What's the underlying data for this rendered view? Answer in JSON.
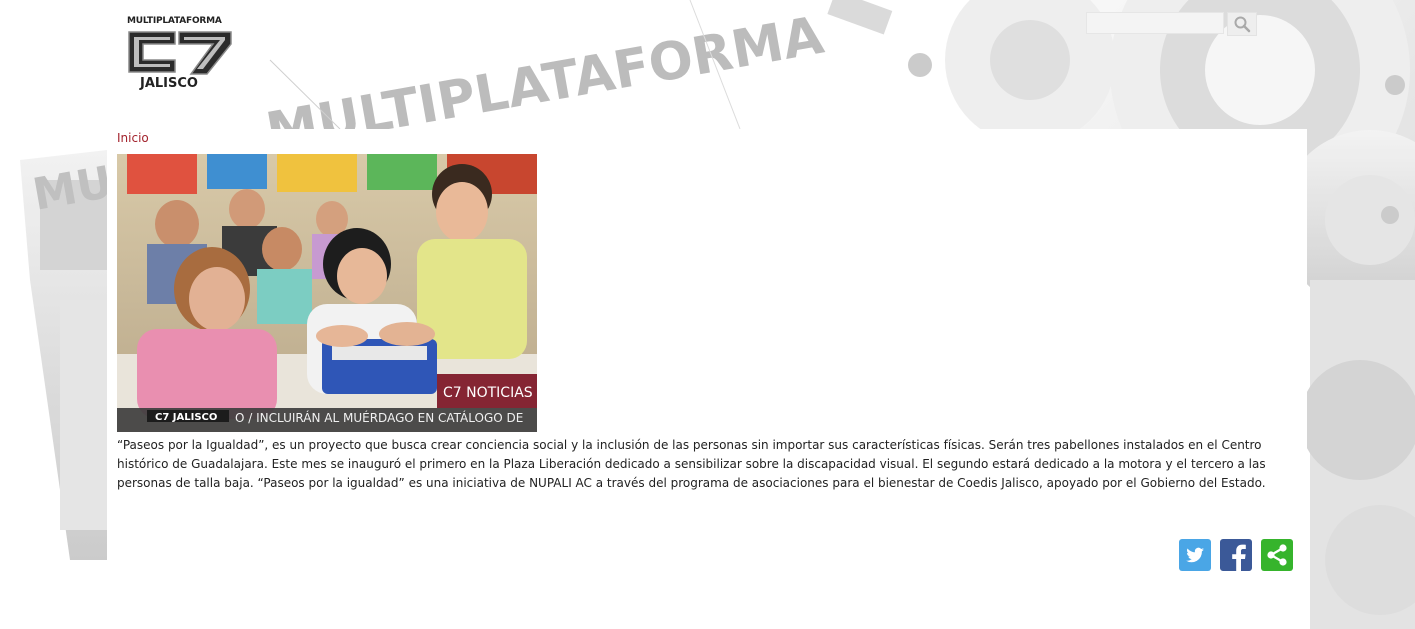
{
  "header": {
    "logo_top": "MULTIPLATAFORMA",
    "logo_mark": "C7",
    "logo_bottom": "JALISCO",
    "background_word": "MULTIPLATAFORMA"
  },
  "search": {
    "value": "",
    "placeholder": ""
  },
  "breadcrumb": {
    "home_label": "Inicio"
  },
  "photo": {
    "overlay_badge": "C7 NOTICIAS",
    "ticker_channel": "C7 JALISCO",
    "ticker_text": "O  /  INCLUIRÁN AL MUÉRDAGO EN CATÁLOGO DE"
  },
  "article": {
    "body": "“Paseos por la Igualdad”, es un proyecto que busca crear conciencia social y la inclusión de las personas sin importar sus características físicas. Serán tres pabellones instalados en el Centro histórico de Guadalajara. Este mes se inauguró el primero en la Plaza Liberación dedicado a sensibilizar sobre la discapacidad visual. El segundo estará dedicado a la motora y el tercero a las personas de talla baja. “Paseos por la igualdad” es una iniciativa de NUPALI AC a través del programa de asociaciones para el bienestar de Coedis Jalisco, apoyado por el Gobierno del Estado."
  },
  "share": {
    "icons": [
      "twitter-icon",
      "facebook-icon",
      "share-icon"
    ]
  },
  "colors": {
    "link": "#a3232d",
    "twitter": "#4aa6e6",
    "facebook": "#3b5998",
    "share": "#36b42c"
  }
}
